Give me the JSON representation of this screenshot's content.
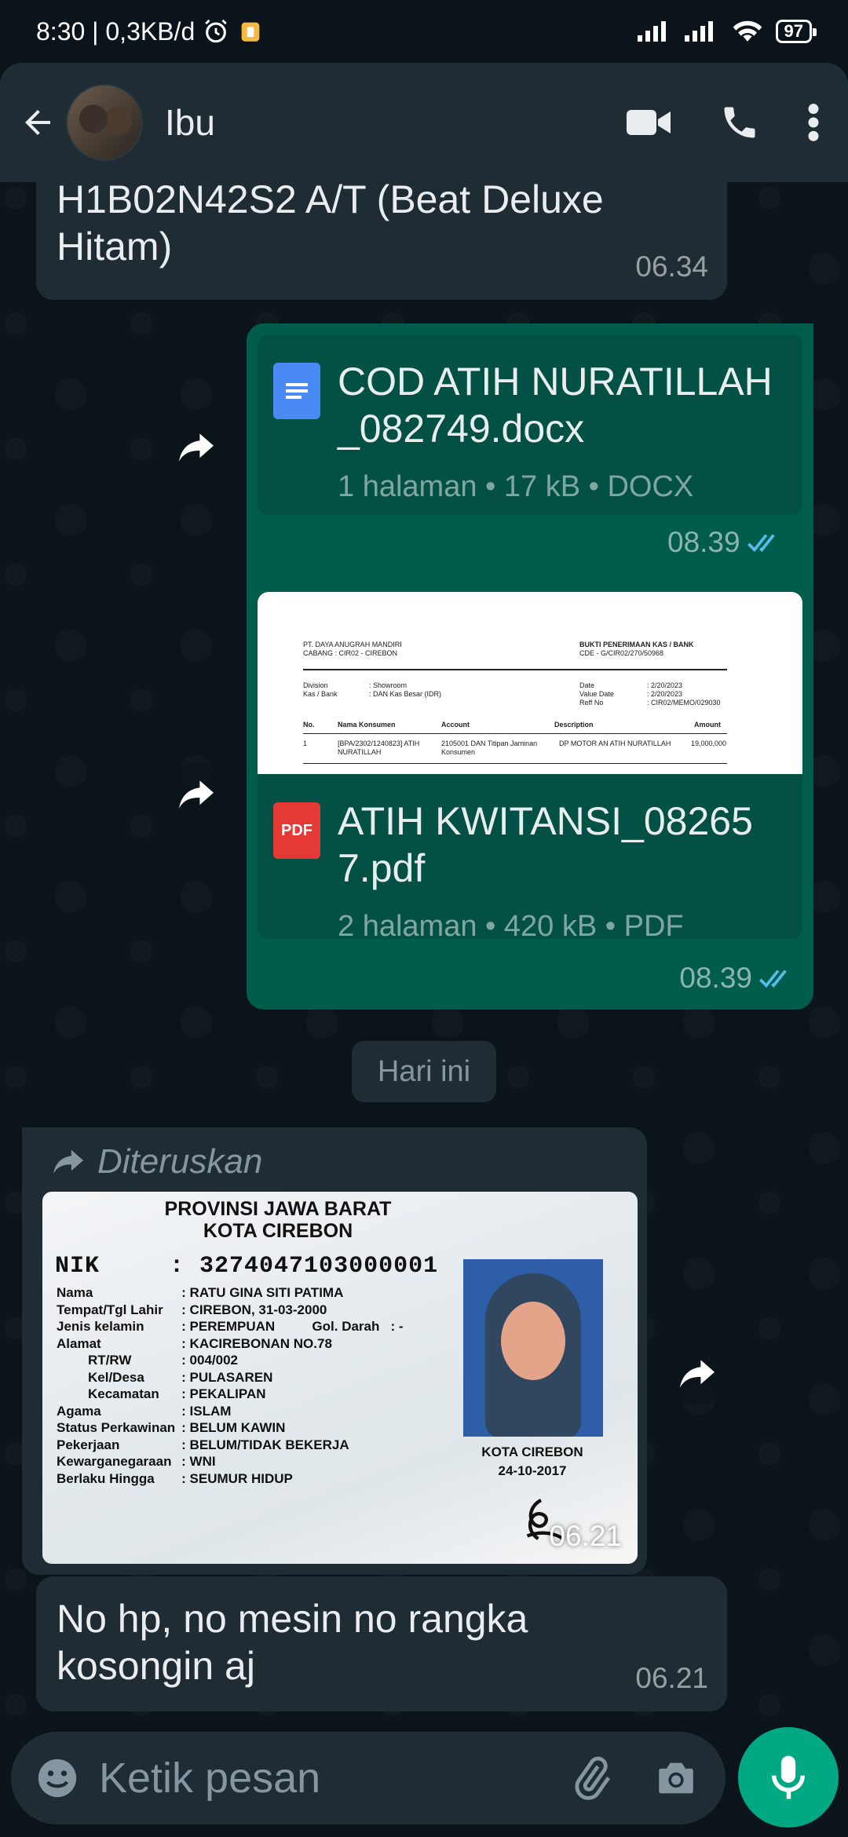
{
  "status_bar": {
    "time_speed": "8:30 | 0,3KB/d",
    "battery": "97",
    "icons": [
      "alarm-icon",
      "notification-icon",
      "signal-icon",
      "signal-icon",
      "wifi-icon",
      "battery-icon"
    ]
  },
  "header": {
    "contact_name": "Ibu",
    "icons": [
      "back-arrow-icon",
      "video-call-icon",
      "phone-icon",
      "more-vert-icon"
    ]
  },
  "messages": {
    "m1": {
      "text": "H1B02N42S2 A/T (Beat Deluxe Hitam)",
      "time": "06.34"
    },
    "m2": {
      "file_name": "COD ATIH NURATILLAH_082749.docx",
      "meta": "1 halaman • 17 kB • DOCX",
      "time": "08.39"
    },
    "m3": {
      "file_name": "ATIH KWITANSI_082657.pdf",
      "meta": "2 halaman • 420 kB • PDF",
      "time": "08.39",
      "icon_label": "PDF",
      "preview": {
        "company": "PT. DAYA ANUGRAH MANDIRI",
        "branch": "CABANG : CIR02 - CIREBON",
        "doc_title": "BUKTI PENERIMAAN KAS / BANK",
        "doc_code": "CDE - G/CIR02/270/50968",
        "division_label": "Division",
        "division_value": ": Showroom",
        "kasbank_label": "Kas / Bank",
        "kasbank_value": ": DAN Kas Besar (IDR)",
        "date_label": "Date",
        "date_value": ": 2/20/2023",
        "valuedate_label": "Value Date",
        "valuedate_value": ": 2/20/2023",
        "reff_label": "Reff No",
        "reff_value": ": CIR02/MEMO/029030",
        "col_no": "No.",
        "col_nama": "Nama Konsumen",
        "col_account": "Account",
        "col_desc": "Description",
        "col_amount": "Amount",
        "row_no": "1",
        "row_nama": "[BPA/2302/1240823] ATIH NURATILLAH",
        "row_account": "2105001 DAN Titipan Jaminan Konsumen",
        "row_desc": "DP MOTOR AN ATIH NURATILLAH",
        "row_amount": "19,000,000"
      }
    },
    "day_separator": "Hari ini",
    "m4": {
      "forwarded_label": "Diteruskan",
      "time": "06.21",
      "ktp": {
        "province": "PROVINSI JAWA BARAT",
        "city": "KOTA CIREBON",
        "nik_label": "NIK",
        "nik_value": ": 3274047103000001",
        "rows": [
          [
            "Nama",
            ": RATU GINA SITI PATIMA"
          ],
          [
            "Tempat/Tgl Lahir",
            ": CIREBON, 31-03-2000"
          ],
          [
            "Jenis kelamin",
            ": PEREMPUAN          Gol. Darah   : -"
          ],
          [
            "Alamat",
            ": KACIREBONAN NO.78"
          ],
          [
            "RT/RW",
            ": 004/002"
          ],
          [
            "Kel/Desa",
            ": PULASAREN"
          ],
          [
            "Kecamatan",
            ": PEKALIPAN"
          ],
          [
            "Agama",
            ": ISLAM"
          ],
          [
            "Status Perkawinan",
            ": BELUM KAWIN"
          ],
          [
            "Pekerjaan",
            ": BELUM/TIDAK BEKERJA"
          ],
          [
            "Kewarganegaraan",
            ": WNI"
          ],
          [
            "Berlaku Hingga",
            ": SEUMUR HIDUP"
          ]
        ],
        "issue_city": "KOTA CIREBON",
        "issue_date": "24-10-2017"
      }
    },
    "m5": {
      "text": "No hp, no mesin no rangka kosongin aj",
      "time": "06.21"
    }
  },
  "input": {
    "placeholder": "Ketik pesan",
    "icons": [
      "emoji-icon",
      "attach-icon",
      "camera-icon",
      "mic-icon"
    ]
  },
  "colors": {
    "background": "#0b141a",
    "incoming_bubble": "#1f2c34",
    "outgoing_bubble": "#005c4b",
    "read_ticks": "#53bdeb",
    "accent": "#00a884"
  }
}
